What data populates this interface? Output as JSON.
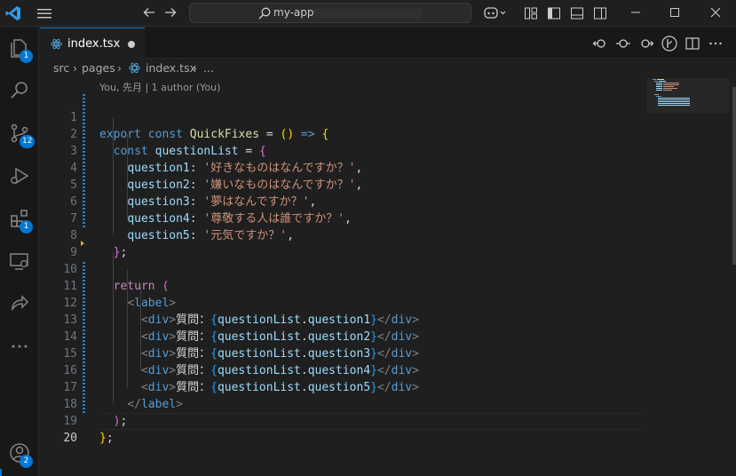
{
  "titlebar": {
    "search_text": "my-app"
  },
  "activity": {
    "explorer_badge": "1",
    "scm_badge": "12",
    "extensions_badge": "1",
    "accounts_badge": "2"
  },
  "tabs": [
    {
      "label": "index.tsx",
      "modified": true
    }
  ],
  "breadcrumb": {
    "parts": [
      "src",
      "pages",
      "index.tsx",
      "..."
    ]
  },
  "editor": {
    "codelens": "You, 先月 | 1 author (You)",
    "line_numbers": [
      "1",
      "2",
      "3",
      "4",
      "5",
      "6",
      "7",
      "8",
      "9",
      "10",
      "11",
      "12",
      "13",
      "14",
      "15",
      "16",
      "17",
      "18",
      "19",
      "20"
    ],
    "q1": "'好きなものはなんですか？'",
    "q2": "'嫌いなものはなんですか？'",
    "q3": "'夢はなんですか？'",
    "q4": "'尊敬する人は誰ですか？'",
    "q5": "'元気ですか？'",
    "jsx_prefix": "質問：",
    "props": [
      "question1",
      "question2",
      "question3",
      "question4",
      "question5"
    ]
  },
  "colors": {
    "accent": "#0078d4",
    "keyword": "#569cd6",
    "string": "#ce9178",
    "function": "#dcdcaa",
    "variable": "#9cdcfe"
  }
}
